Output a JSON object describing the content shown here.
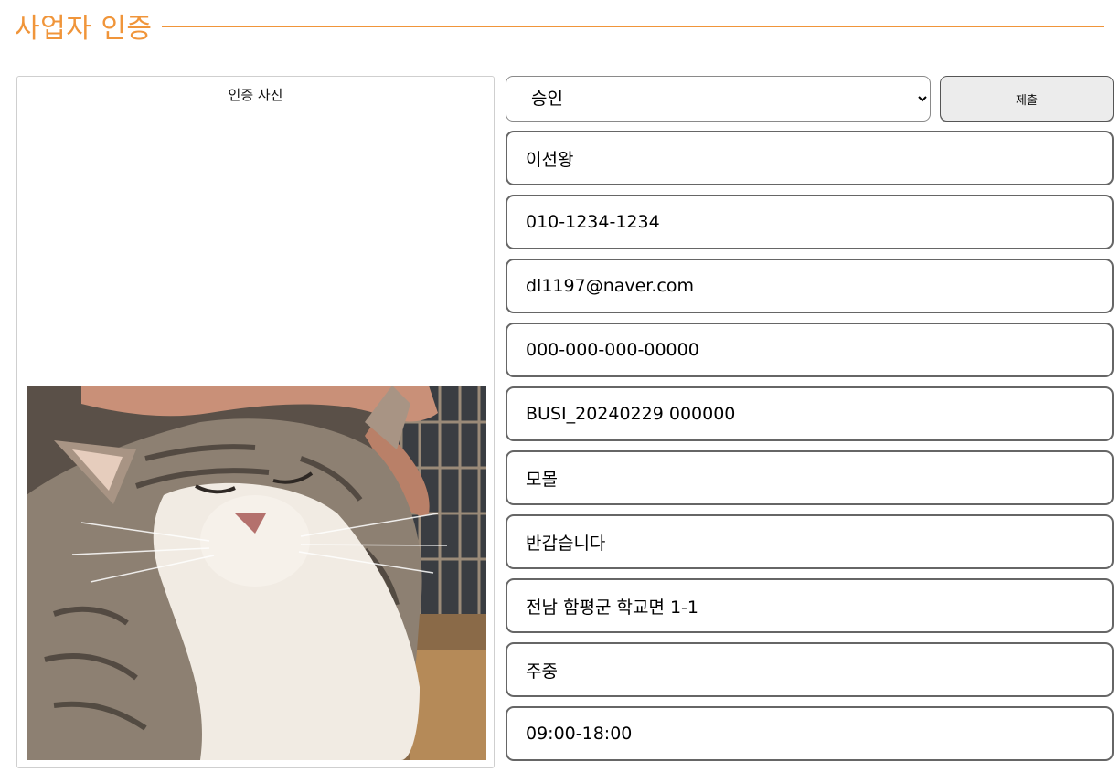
{
  "page": {
    "title": "사업자 인증"
  },
  "photo": {
    "caption": "인증 사진"
  },
  "form": {
    "status_selected": "승인",
    "submit_label": "제출",
    "fields": [
      "이선왕",
      "010-1234-1234",
      "dl1197@naver.com",
      "000-000-000-00000",
      "BUSI_20240229 000000",
      "모몰",
      "반갑습니다",
      "전남 함평군 학교면 1-1",
      "주중",
      "09:00-18:00"
    ]
  },
  "colors": {
    "accent": "#f0953a"
  }
}
